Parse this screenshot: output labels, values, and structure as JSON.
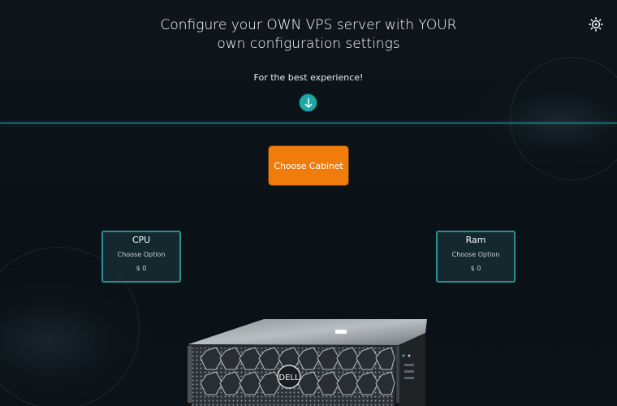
{
  "header": {
    "title": "Configure your OWN VPS server with YOUR own configuration settings",
    "subtitle": "For the best experience!",
    "down_icon": "arrow-down-icon",
    "settings_icon": "gear-icon"
  },
  "cabinet": {
    "button_label": "Choose Cabinet"
  },
  "options": [
    {
      "title": "CPU",
      "choose_label": "Choose Option",
      "price": "$ 0"
    },
    {
      "title": "Ram",
      "choose_label": "Choose Option",
      "price": "$ 0"
    }
  ],
  "server": {
    "brand": "DELL"
  },
  "colors": {
    "background": "#0b1319",
    "accent_teal": "#2aa7ad",
    "button_orange": "#f07d0b",
    "card_border": "#2a8f91"
  }
}
